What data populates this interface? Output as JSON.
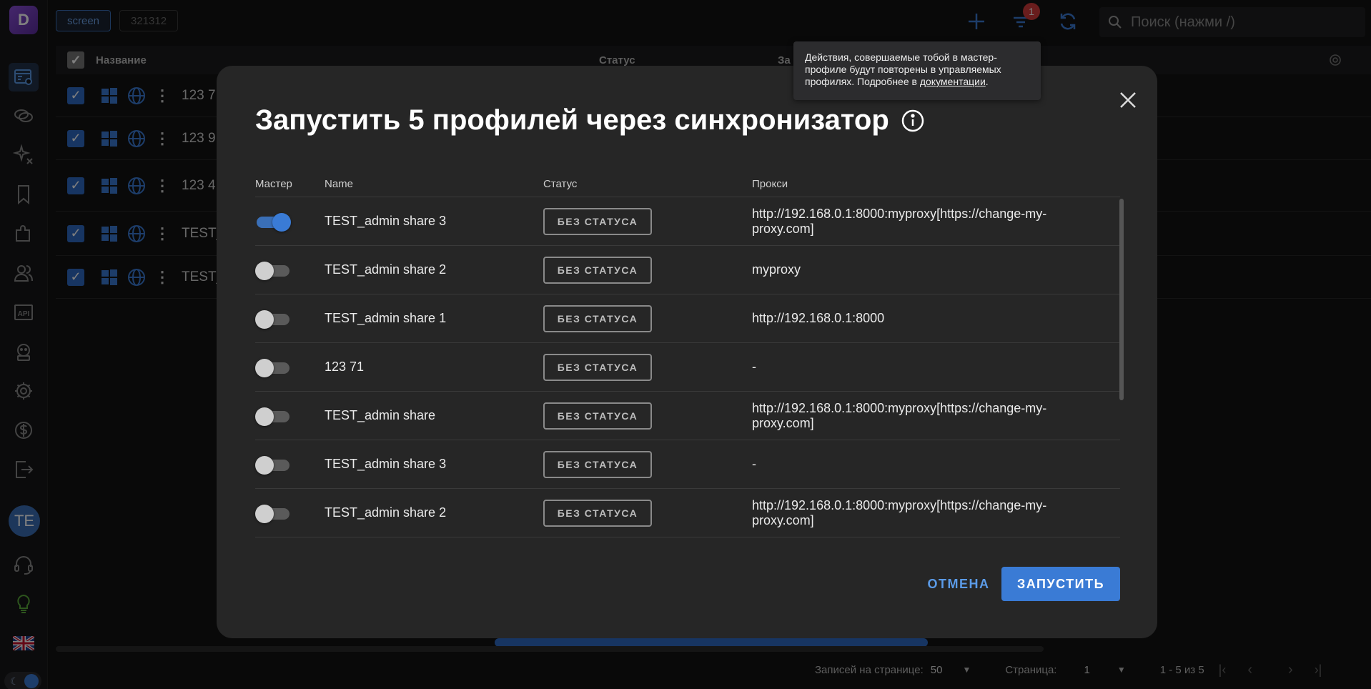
{
  "app": {
    "logo_letter": "D"
  },
  "topbar": {
    "tags": [
      "screen",
      "321312"
    ],
    "notifications_count": "1",
    "search_placeholder": "Поиск (нажми /)"
  },
  "sidebar": {
    "avatar_initials": "TE",
    "api_label": "API"
  },
  "bg_table": {
    "columns": {
      "name": "Название",
      "status": "Статус",
      "third": "За"
    },
    "rows": [
      "123 7",
      "123 9",
      "123 4 1",
      "TEST_a",
      "TEST_a"
    ]
  },
  "pagination": {
    "per_page_label": "Записей на странице:",
    "per_page_value": "50",
    "page_label": "Страница:",
    "page_value": "1",
    "range": "1 - 5 из 5"
  },
  "modal": {
    "title": "Запустить 5 профилей через синхронизатор",
    "columns": {
      "master": "Мастер",
      "name": "Name",
      "status": "Статус",
      "proxy": "Прокси"
    },
    "rows": [
      {
        "master": true,
        "name": "TEST_admin share 3",
        "status": "БЕЗ СТАТУСА",
        "proxy": "http://192.168.0.1:8000:myproxy[https://change-my-proxy.com]"
      },
      {
        "master": false,
        "name": "TEST_admin share 2",
        "status": "БЕЗ СТАТУСА",
        "proxy": "myproxy"
      },
      {
        "master": false,
        "name": "TEST_admin share 1",
        "status": "БЕЗ СТАТУСА",
        "proxy": "http://192.168.0.1:8000"
      },
      {
        "master": false,
        "name": "123 71",
        "status": "БЕЗ СТАТУСА",
        "proxy": "-"
      },
      {
        "master": false,
        "name": "TEST_admin share",
        "status": "БЕЗ СТАТУСА",
        "proxy": "http://192.168.0.1:8000:myproxy[https://change-my-proxy.com]"
      },
      {
        "master": false,
        "name": "TEST_admin share 3",
        "status": "БЕЗ СТАТУСА",
        "proxy": "-"
      },
      {
        "master": false,
        "name": "TEST_admin share 2",
        "status": "БЕЗ СТАТУСА",
        "proxy": "http://192.168.0.1:8000:myproxy[https://change-my-proxy.com]"
      }
    ],
    "cancel_label": "ОТМЕНА",
    "run_label": "ЗАПУСТИТЬ"
  },
  "tooltip": {
    "text": "Действия, совершаемые тобой в мастер-профиле будут повторены в управляемых профилях. Подробнее в ",
    "link": "документации",
    "suffix": "."
  },
  "colors": {
    "accent": "#3a7bd5",
    "background": "#121212",
    "modal": "#262626",
    "badge": "#d23b3b"
  }
}
